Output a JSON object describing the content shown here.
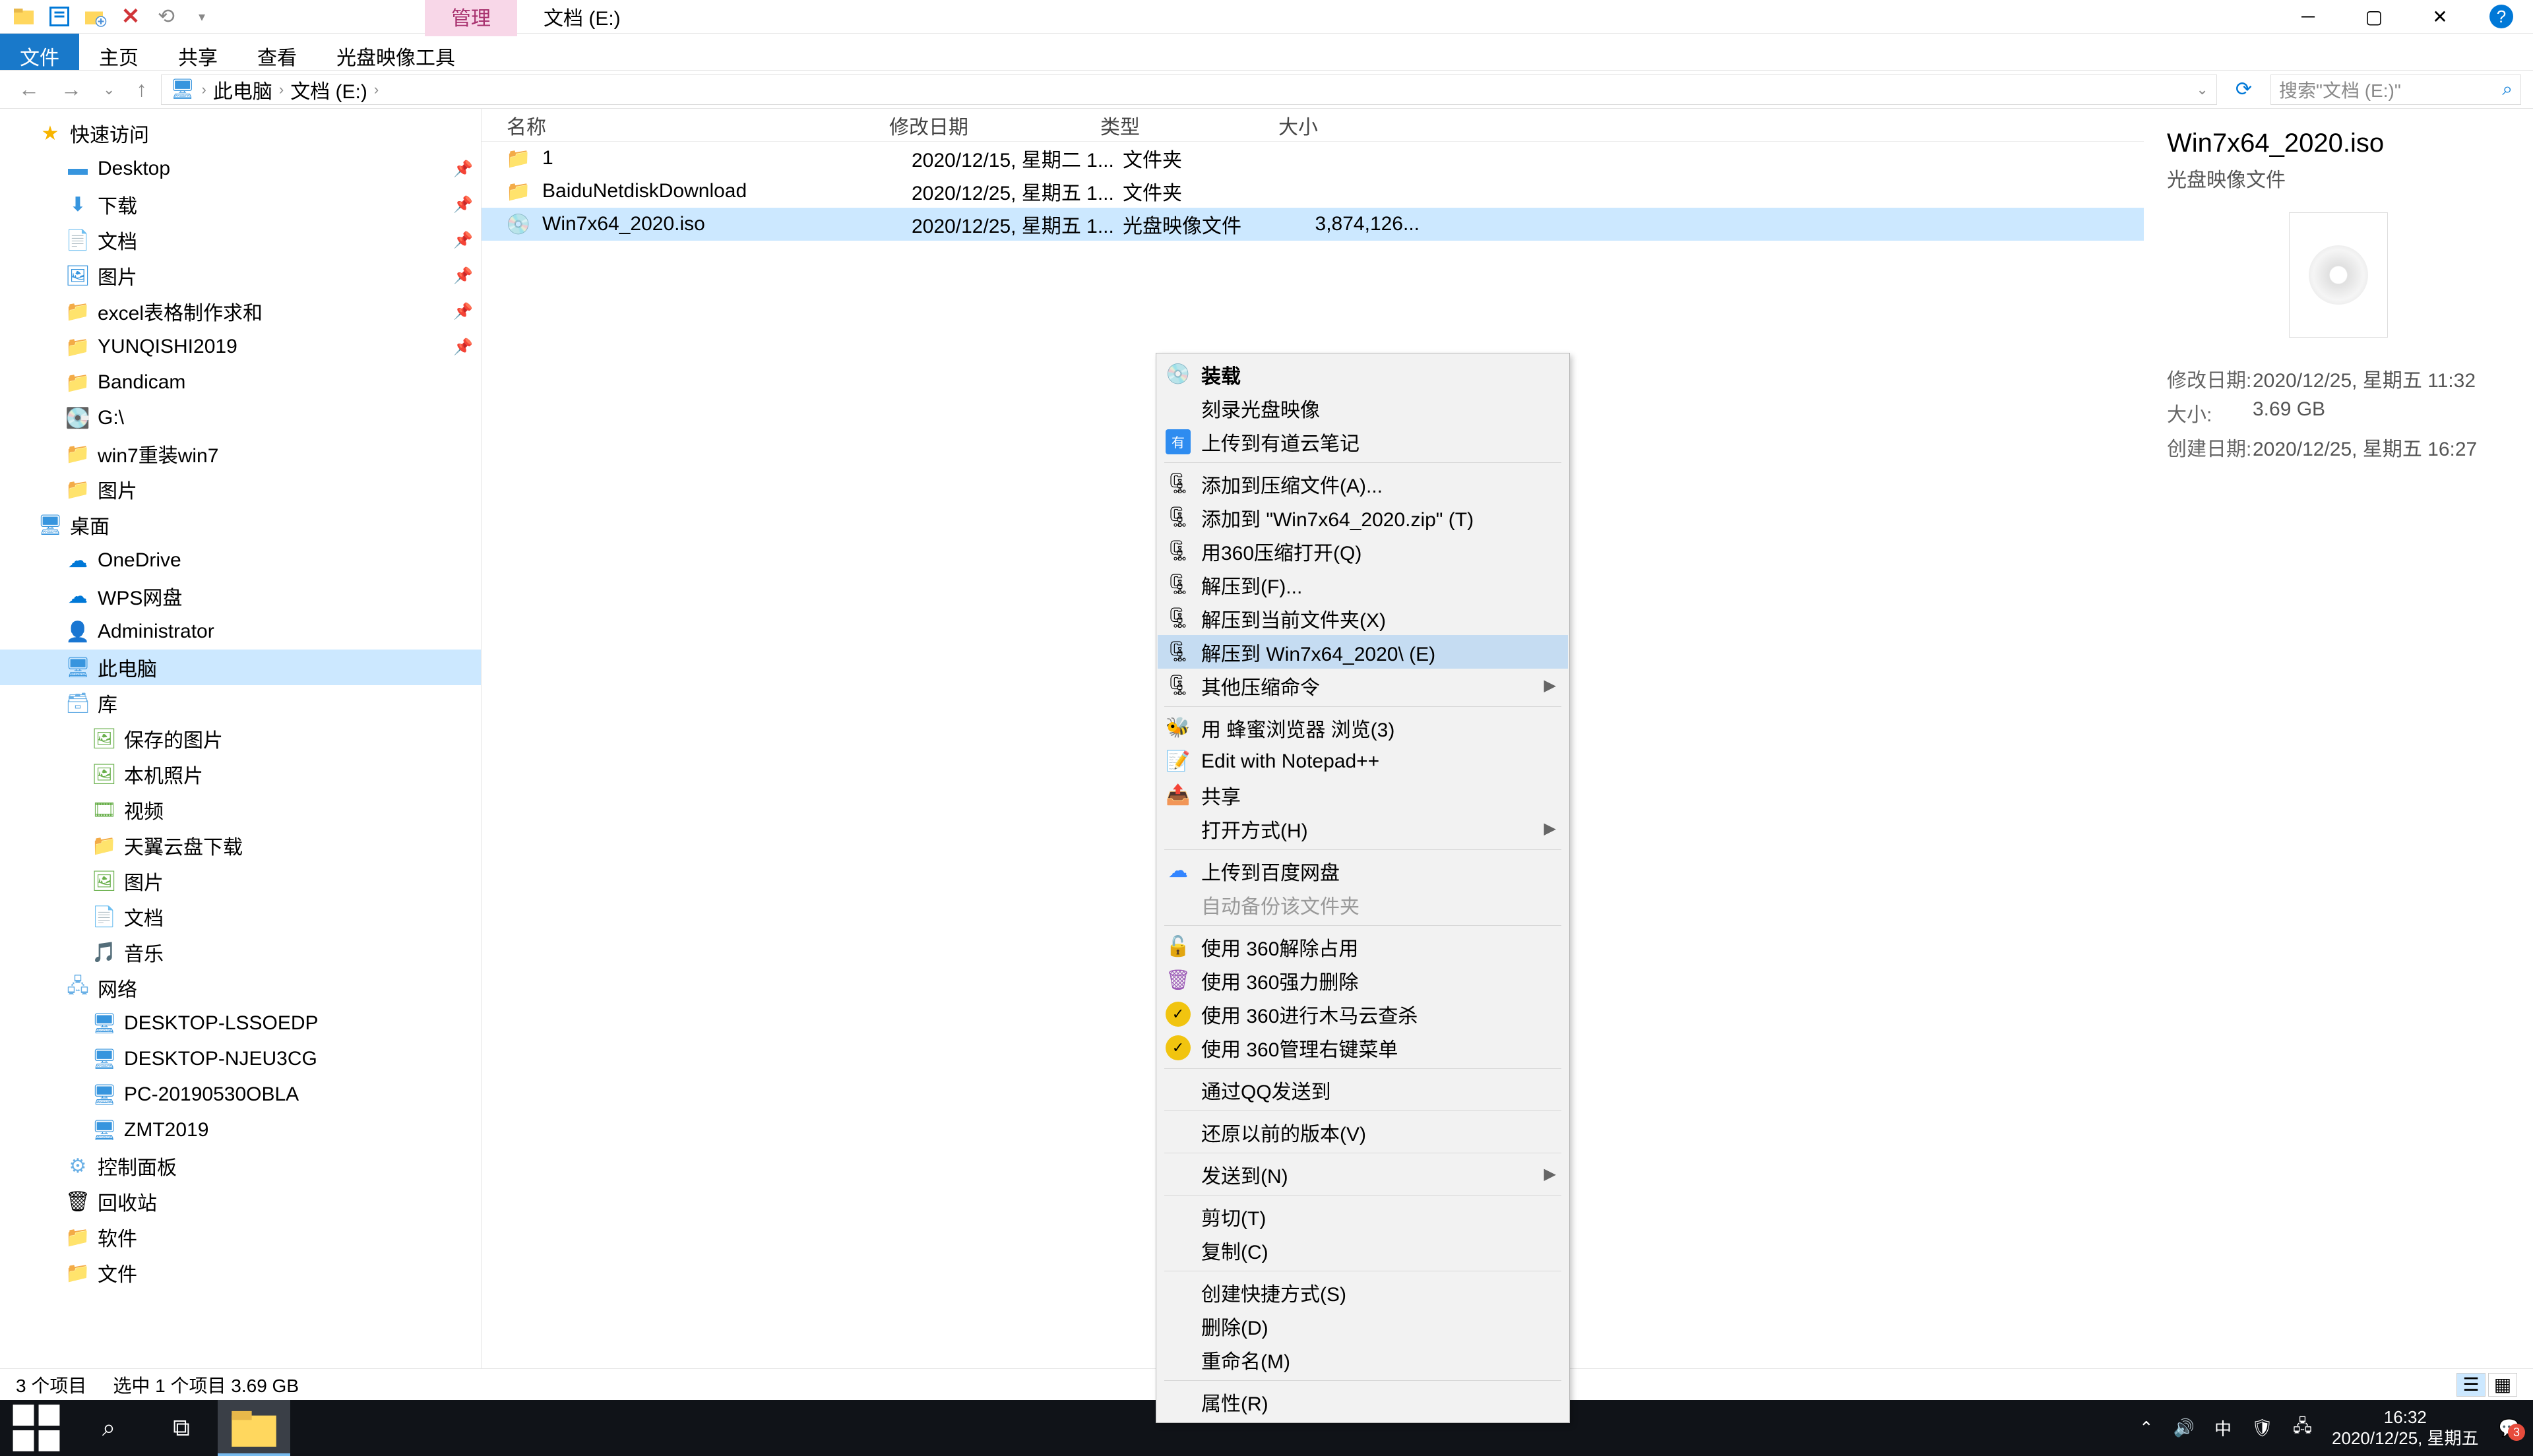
{
  "title_bar": {
    "manage_tab": "管理",
    "location_tab": "文档 (E:)"
  },
  "ribbon": {
    "file": "文件",
    "home": "主页",
    "share": "共享",
    "view": "查看",
    "disc_tools": "光盘映像工具"
  },
  "breadcrumb": {
    "pc": "此电脑",
    "drive": "文档 (E:)"
  },
  "search_placeholder": "搜索\"文档 (E:)\"",
  "nav": {
    "quick": "快速访问",
    "desktop": "Desktop",
    "downloads": "下载",
    "documents": "文档",
    "pictures": "图片",
    "excel": "excel表格制作求和",
    "yunqishi": "YUNQISHI2019",
    "bandicam": "Bandicam",
    "gdrive": "G:\\",
    "win7reinstall": "win7重装win7",
    "pictures2": "图片",
    "desktop_cn": "桌面",
    "onedrive": "OneDrive",
    "wps": "WPS网盘",
    "admin": "Administrator",
    "thispc": "此电脑",
    "library": "库",
    "saved_pics": "保存的图片",
    "camera": "本机照片",
    "videos": "视频",
    "tianyi": "天翼云盘下载",
    "pics3": "图片",
    "docs2": "文档",
    "music": "音乐",
    "network": "网络",
    "pc1": "DESKTOP-LSSOEDP",
    "pc2": "DESKTOP-NJEU3CG",
    "pc3": "PC-20190530OBLA",
    "pc4": "ZMT2019",
    "control": "控制面板",
    "recycle": "回收站",
    "software": "软件",
    "files": "文件"
  },
  "columns": {
    "name": "名称",
    "date": "修改日期",
    "type": "类型",
    "size": "大小"
  },
  "rows": [
    {
      "name": "1",
      "date": "2020/12/15, 星期二 1...",
      "type": "文件夹",
      "size": ""
    },
    {
      "name": "BaiduNetdiskDownload",
      "date": "2020/12/25, 星期五 1...",
      "type": "文件夹",
      "size": ""
    },
    {
      "name": "Win7x64_2020.iso",
      "date": "2020/12/25, 星期五 1...",
      "type": "光盘映像文件",
      "size": "3,874,126..."
    }
  ],
  "ctx": {
    "mount": "装载",
    "burn": "刻录光盘映像",
    "upload_youdao": "上传到有道云笔记",
    "add_archive": "添加到压缩文件(A)...",
    "add_zip": "添加到 \"Win7x64_2020.zip\" (T)",
    "open_360zip": "用360压缩打开(Q)",
    "extract_to": "解压到(F)...",
    "extract_here": "解压到当前文件夹(X)",
    "extract_named": "解压到 Win7x64_2020\\ (E)",
    "other_zip": "其他压缩命令",
    "honey_browser": "用 蜂蜜浏览器 浏览(3)",
    "notepadpp": "Edit with Notepad++",
    "share": "共享",
    "open_with": "打开方式(H)",
    "upload_baidu": "上传到百度网盘",
    "auto_backup": "自动备份该文件夹",
    "use360_unlock": "使用 360解除占用",
    "use360_delete": "使用 360强力删除",
    "use360_trojan": "使用 360进行木马云查杀",
    "use360_menu": "使用 360管理右键菜单",
    "qq_send": "通过QQ发送到",
    "restore": "还原以前的版本(V)",
    "send_to": "发送到(N)",
    "cut": "剪切(T)",
    "copy": "复制(C)",
    "shortcut": "创建快捷方式(S)",
    "delete": "删除(D)",
    "rename": "重命名(M)",
    "properties": "属性(R)"
  },
  "preview": {
    "title": "Win7x64_2020.iso",
    "subtitle": "光盘映像文件",
    "mod_label": "修改日期:",
    "mod_val": "2020/12/25, 星期五 11:32",
    "size_label": "大小:",
    "size_val": "3.69 GB",
    "created_label": "创建日期:",
    "created_val": "2020/12/25, 星期五 16:27"
  },
  "status": {
    "count": "3 个项目",
    "selected": "选中 1 个项目  3.69 GB"
  },
  "taskbar": {
    "ime": "中",
    "time": "16:32",
    "date": "2020/12/25, 星期五",
    "notif_count": "3"
  }
}
